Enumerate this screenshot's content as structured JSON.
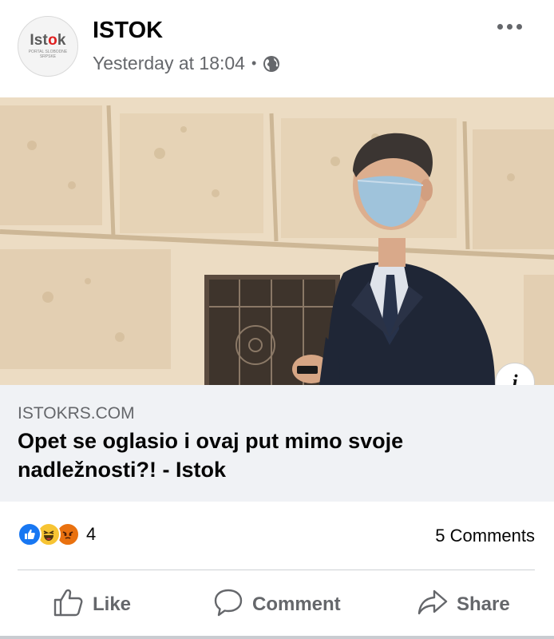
{
  "post": {
    "page_name": "ISTOK",
    "timestamp": "Yesterday at 18:04",
    "separator": "•",
    "audience_icon": "globe-icon",
    "avatar": {
      "logo_prefix": "Ist",
      "logo_accent": "o",
      "logo_suffix": "k",
      "tagline": "PORTAL SLOBODNE SRPSKE"
    },
    "more_icon": "more-horizontal-icon"
  },
  "link_preview": {
    "domain": "ISTOKRS.COM",
    "title": "Opet se oglasio i ovaj put mimo svoje nadležnosti?! - Istok",
    "info_label": "i"
  },
  "stats": {
    "reaction_icons": [
      "like-reaction-icon",
      "haha-reaction-icon",
      "angry-reaction-icon"
    ],
    "reaction_count": "4",
    "comments": "5 Comments"
  },
  "actions": {
    "like": "Like",
    "comment": "Comment",
    "share": "Share"
  },
  "colors": {
    "secondary_text": "#65676b",
    "card_background": "#f0f2f5",
    "like_blue": "#1877f2",
    "haha_yellow": "#f7c433",
    "angry_orange": "#e9710f"
  }
}
